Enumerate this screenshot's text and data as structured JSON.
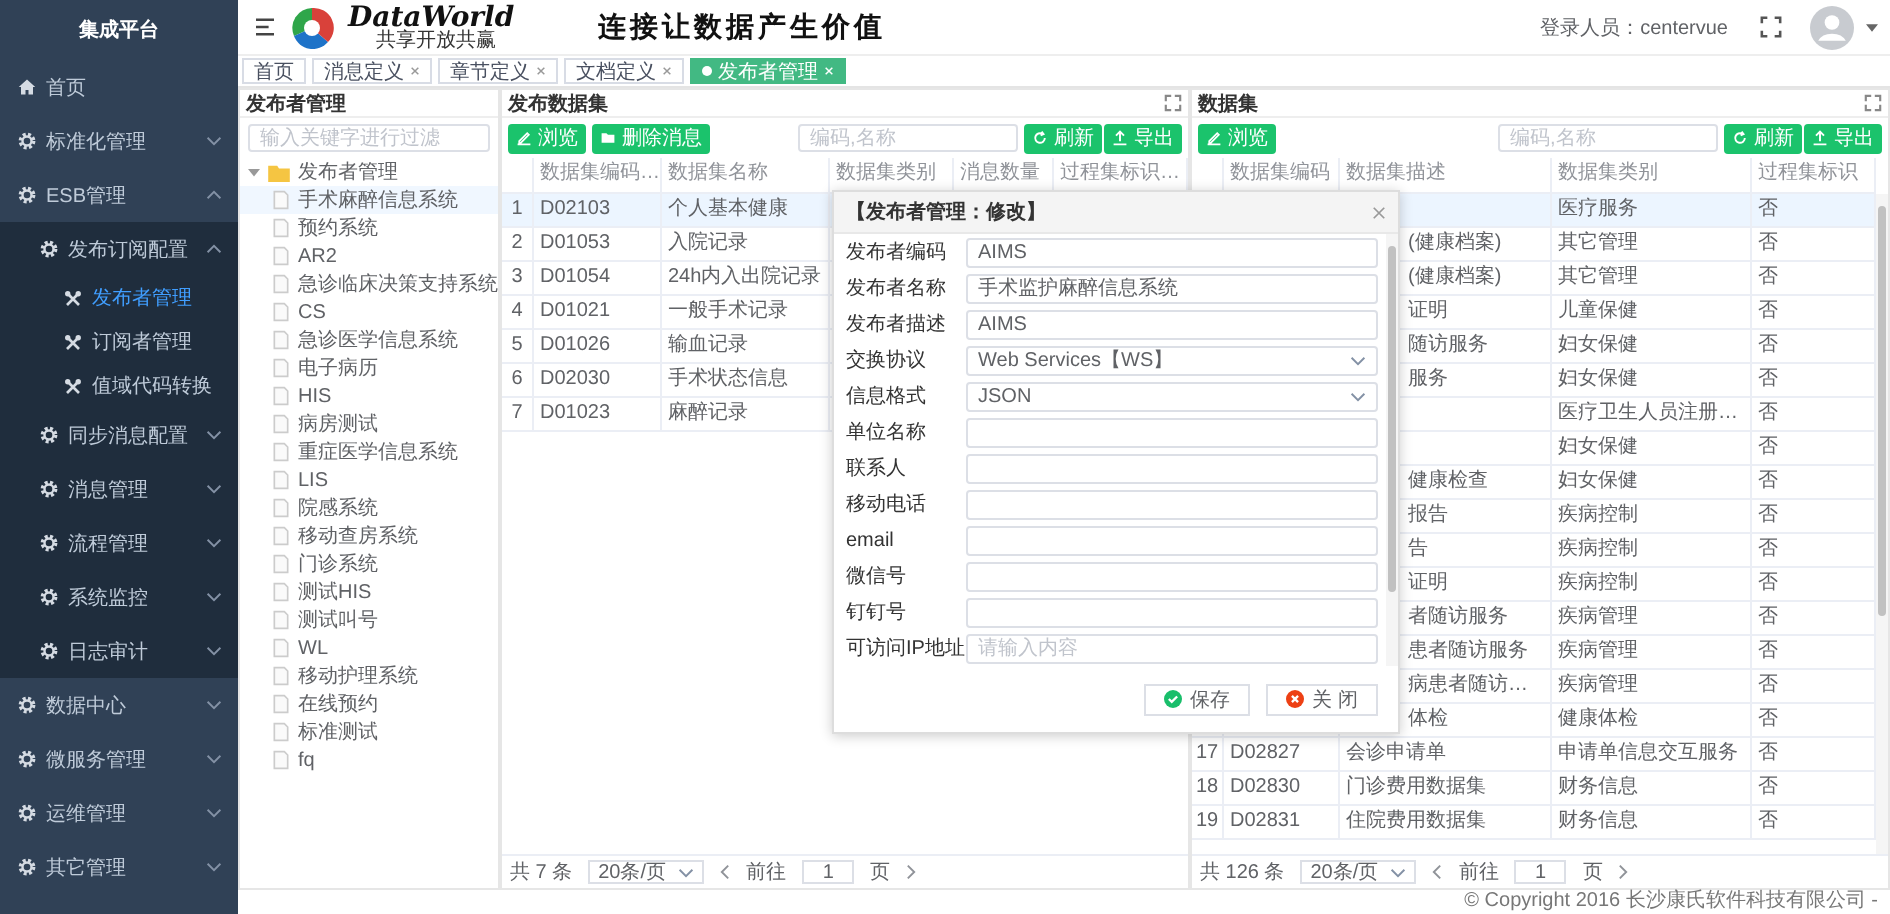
{
  "sidebar": {
    "title": "集成平台",
    "items": [
      {
        "label": "首页",
        "kind": "home",
        "selected": false
      },
      {
        "label": "标准化管理",
        "kind": "menu",
        "expanded": false,
        "selected": false
      },
      {
        "label": "ESB管理",
        "kind": "menu",
        "expanded": true,
        "selected": false,
        "children": [
          {
            "label": "发布订阅配置",
            "kind": "menu",
            "expanded": true,
            "selected": false,
            "children": [
              {
                "label": "发布者管理",
                "kind": "page",
                "selected": true
              },
              {
                "label": "订阅者管理",
                "kind": "page",
                "selected": false
              },
              {
                "label": "值域代码转换",
                "kind": "page",
                "selected": false
              }
            ]
          },
          {
            "label": "同步消息配置",
            "kind": "menu",
            "expanded": false,
            "selected": false
          },
          {
            "label": "消息管理",
            "kind": "menu",
            "expanded": false,
            "selected": false
          },
          {
            "label": "流程管理",
            "kind": "menu",
            "expanded": false,
            "selected": false
          },
          {
            "label": "系统监控",
            "kind": "menu",
            "expanded": false,
            "selected": false
          },
          {
            "label": "日志审计",
            "kind": "menu",
            "expanded": false,
            "selected": false
          }
        ]
      },
      {
        "label": "数据中心",
        "kind": "menu",
        "expanded": false,
        "selected": false
      },
      {
        "label": "微服务管理",
        "kind": "menu",
        "expanded": false,
        "selected": false
      },
      {
        "label": "运维管理",
        "kind": "menu",
        "expanded": false,
        "selected": false
      },
      {
        "label": "其它管理",
        "kind": "menu",
        "expanded": false,
        "selected": false
      }
    ]
  },
  "header": {
    "brand": "DataWorld",
    "tagline": "共享开放共赢",
    "slogan": "连接让数据产生价值",
    "user_label": "登录人员：centervue"
  },
  "tabs": [
    {
      "label": "首页",
      "closable": false,
      "selected": false
    },
    {
      "label": "消息定义",
      "closable": true,
      "selected": false
    },
    {
      "label": "章节定义",
      "closable": true,
      "selected": false
    },
    {
      "label": "文档定义",
      "closable": true,
      "selected": false
    },
    {
      "label": "发布者管理",
      "closable": true,
      "selected": true
    }
  ],
  "publisher_panel": {
    "title": "发布者管理",
    "filter": {
      "placeholder": "输入关键字进行过滤"
    },
    "tree": {
      "label": "发布者管理",
      "expanded": true,
      "children": [
        {
          "label": "手术麻醉信息系统",
          "selected": true
        },
        {
          "label": "预约系统",
          "selected": false
        },
        {
          "label": "AR2",
          "selected": false
        },
        {
          "label": "急诊临床决策支持系统",
          "selected": false
        },
        {
          "label": "CS",
          "selected": false
        },
        {
          "label": "急诊医学信息系统",
          "selected": false
        },
        {
          "label": "电子病历",
          "selected": false
        },
        {
          "label": "HIS",
          "selected": false
        },
        {
          "label": "病房测试",
          "selected": false
        },
        {
          "label": "重症医学信息系统",
          "selected": false
        },
        {
          "label": "LIS",
          "selected": false
        },
        {
          "label": "院感系统",
          "selected": false
        },
        {
          "label": "移动查房系统",
          "selected": false
        },
        {
          "label": "门诊系统",
          "selected": false
        },
        {
          "label": "测试HIS",
          "selected": false
        },
        {
          "label": "测试叫号",
          "selected": false
        },
        {
          "label": "WL",
          "selected": false
        },
        {
          "label": "移动护理系统",
          "selected": false
        },
        {
          "label": "在线预约",
          "selected": false
        },
        {
          "label": "标准测试",
          "selected": false
        },
        {
          "label": "fq",
          "selected": false
        }
      ]
    }
  },
  "dataset_panel": {
    "title": "发布数据集",
    "buttons": [
      {
        "label": "浏览",
        "kind": "browse"
      },
      {
        "label": "删除消息",
        "kind": "delete"
      }
    ],
    "search": {
      "placeholder": "编码,名称"
    },
    "actions": [
      {
        "label": "刷新",
        "kind": "refresh"
      },
      {
        "label": "导出",
        "kind": "export"
      }
    ],
    "columns": [
      "数据集编码…",
      "数据集名称",
      "数据集类别",
      "消息数量",
      "过程集标识…"
    ],
    "rows": [
      {
        "index": "1",
        "code": "D02103",
        "name": "个人基本健康",
        "selected": true
      },
      {
        "index": "2",
        "code": "D01053",
        "name": "入院记录",
        "selected": false
      },
      {
        "index": "3",
        "code": "D01054",
        "name": "24h内入出院记录",
        "selected": false
      },
      {
        "index": "4",
        "code": "D01021",
        "name": "一般手术记录",
        "selected": false
      },
      {
        "index": "5",
        "code": "D01026",
        "name": "输血记录",
        "selected": false
      },
      {
        "index": "6",
        "code": "D02030",
        "name": "手术状态信息",
        "selected": false
      },
      {
        "index": "7",
        "code": "D01023",
        "name": "麻醉记录",
        "selected": false
      }
    ],
    "pagination": {
      "total": "共 7 条",
      "page_size": "20条/页",
      "goto_label": "前往",
      "page": "1",
      "page_unit": "页"
    }
  },
  "catalog_panel": {
    "title": "数据集",
    "buttons": [
      {
        "label": "浏览",
        "kind": "browse"
      }
    ],
    "search": {
      "placeholder": "编码,名称"
    },
    "actions": [
      {
        "label": "刷新",
        "kind": "refresh"
      },
      {
        "label": "导出",
        "kind": "export"
      }
    ],
    "columns": [
      "数据集编码",
      "数据集描述",
      "数据集类别",
      "过程集标识"
    ],
    "rows": [
      {
        "category": "医疗服务",
        "flag": "否",
        "selected": true
      },
      {
        "description": "(健康档案)",
        "category": "其它管理",
        "flag": "否",
        "selected": false
      },
      {
        "description": "(健康档案)",
        "category": "其它管理",
        "flag": "否",
        "selected": false
      },
      {
        "description": "证明",
        "category": "儿童保健",
        "flag": "否",
        "selected": false
      },
      {
        "description": "随访服务",
        "category": "妇女保健",
        "flag": "否",
        "selected": false
      },
      {
        "description": "服务",
        "category": "妇女保健",
        "flag": "否",
        "selected": false
      },
      {
        "category": "医疗卫生人员注册…",
        "flag": "否",
        "selected": false
      },
      {
        "category": "妇女保健",
        "flag": "否",
        "selected": false
      },
      {
        "description": "健康检查",
        "category": "妇女保健",
        "flag": "否",
        "selected": false
      },
      {
        "description": "报告",
        "category": "疾病控制",
        "flag": "否",
        "selected": false
      },
      {
        "description": "告",
        "category": "疾病控制",
        "flag": "否",
        "selected": false
      },
      {
        "description": "证明",
        "category": "疾病控制",
        "flag": "否",
        "selected": false
      },
      {
        "description": "者随访服务",
        "category": "疾病管理",
        "flag": "否",
        "selected": false
      },
      {
        "description": "患者随访服务",
        "category": "疾病管理",
        "flag": "否",
        "selected": false
      },
      {
        "description": "病患者随访…",
        "category": "疾病管理",
        "flag": "否",
        "selected": false
      },
      {
        "description": "体检",
        "category": "健康体检",
        "flag": "否",
        "selected": false
      },
      {
        "index": "17",
        "code": "D02827",
        "description": "会诊申请单",
        "category": "申请单信息交互服务",
        "flag": "否",
        "selected": false
      },
      {
        "index": "18",
        "code": "D02830",
        "description": "门诊费用数据集",
        "category": "财务信息",
        "flag": "否",
        "selected": false
      },
      {
        "index": "19",
        "code": "D02831",
        "description": "住院费用数据集",
        "category": "财务信息",
        "flag": "否",
        "selected": false
      }
    ],
    "pagination": {
      "total": "共 126 条",
      "page_size": "20条/页",
      "goto_label": "前往",
      "page": "1",
      "page_unit": "页"
    }
  },
  "dialog": {
    "title": "【发布者管理：修改】",
    "fields": [
      {
        "label": "发布者编码",
        "kind": "text",
        "value": "AIMS"
      },
      {
        "label": "发布者名称",
        "kind": "text",
        "value": "手术监护麻醉信息系统"
      },
      {
        "label": "发布者描述",
        "kind": "text",
        "value": "AIMS"
      },
      {
        "label": "交换协议",
        "kind": "select",
        "value": "Web Services【WS】"
      },
      {
        "label": "信息格式",
        "kind": "select",
        "value": "JSON"
      },
      {
        "label": "单位名称",
        "kind": "text"
      },
      {
        "label": "联系人",
        "kind": "text"
      },
      {
        "label": "移动电话",
        "kind": "text"
      },
      {
        "label": "email",
        "kind": "text"
      },
      {
        "label": "微信号",
        "kind": "text"
      },
      {
        "label": "钉钉号",
        "kind": "text"
      },
      {
        "label": "可访问IP地址",
        "kind": "text",
        "placeholder": "请输入内容"
      }
    ],
    "buttons": [
      {
        "label": "保存",
        "kind": "save"
      },
      {
        "label": "关 闭",
        "kind": "close"
      }
    ]
  },
  "footer": {
    "copyright": "© Copyright 2016 长沙康氏软件科技有限公司 -"
  }
}
